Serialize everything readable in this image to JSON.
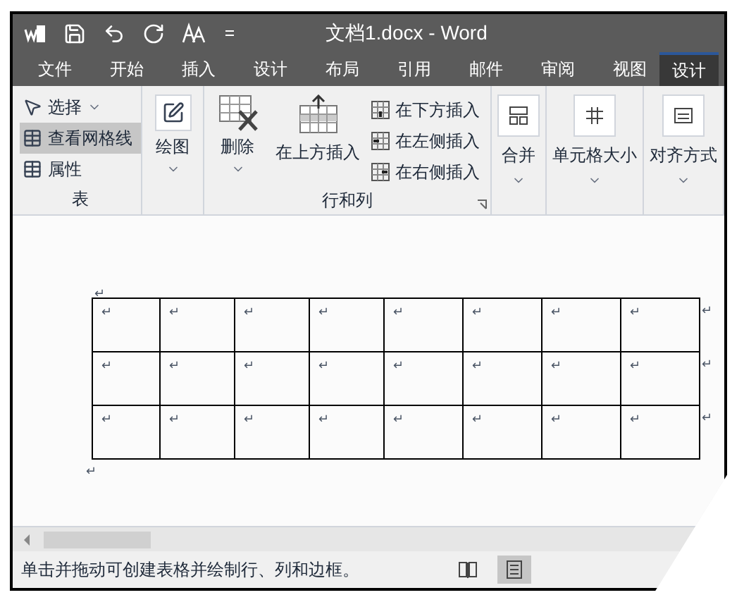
{
  "window": {
    "title": "文档1.docx - Word"
  },
  "tabs": [
    {
      "label": "文件",
      "selected": false
    },
    {
      "label": "开始",
      "selected": false
    },
    {
      "label": "插入",
      "selected": false
    },
    {
      "label": "设计",
      "selected": false
    },
    {
      "label": "布局",
      "selected": false
    },
    {
      "label": "引用",
      "selected": false
    },
    {
      "label": "邮件",
      "selected": false
    },
    {
      "label": "审阅",
      "selected": false
    },
    {
      "label": "视图",
      "selected": false
    },
    {
      "label": "设计",
      "selected": true
    }
  ],
  "ribbon": {
    "table_group": {
      "label": "表",
      "items": [
        {
          "kind": "select",
          "label": "选择",
          "selected": false
        },
        {
          "kind": "gridlines",
          "label": "查看网格线",
          "selected": true
        },
        {
          "kind": "properties",
          "label": "属性",
          "selected": false
        }
      ]
    },
    "draw": {
      "label": "绘图"
    },
    "rows_columns": {
      "label": "行和列",
      "delete": "删除",
      "insert_above": "在上方插入",
      "small_buttons": [
        {
          "kind": "below",
          "label": "在下方插入"
        },
        {
          "kind": "left",
          "label": "在左侧插入"
        },
        {
          "kind": "right",
          "label": "在右侧插入"
        }
      ]
    },
    "big_buttons": [
      {
        "kind": "merge",
        "label": "合并"
      },
      {
        "kind": "cell_size",
        "label": "单元格大小"
      },
      {
        "kind": "align",
        "label": "对齐方式"
      }
    ]
  },
  "document": {
    "top_mark": "↵",
    "table": [
      [
        "↵",
        "↵",
        "↵",
        "↵",
        "↵",
        "↵",
        "↵",
        "↵"
      ],
      [
        "↵",
        "↵",
        "↵",
        "↵",
        "↵",
        "↵",
        "↵",
        "↵"
      ],
      [
        "↵",
        "↵",
        "↵",
        "↵",
        "↵",
        "↵",
        "↵",
        "↵"
      ]
    ],
    "row_end_marks": [
      "↵",
      "↵",
      "↵"
    ],
    "after_mark": "↵"
  },
  "status_bar": {
    "text": "单击并拖动可创建表格并绘制行、列和边框。"
  }
}
